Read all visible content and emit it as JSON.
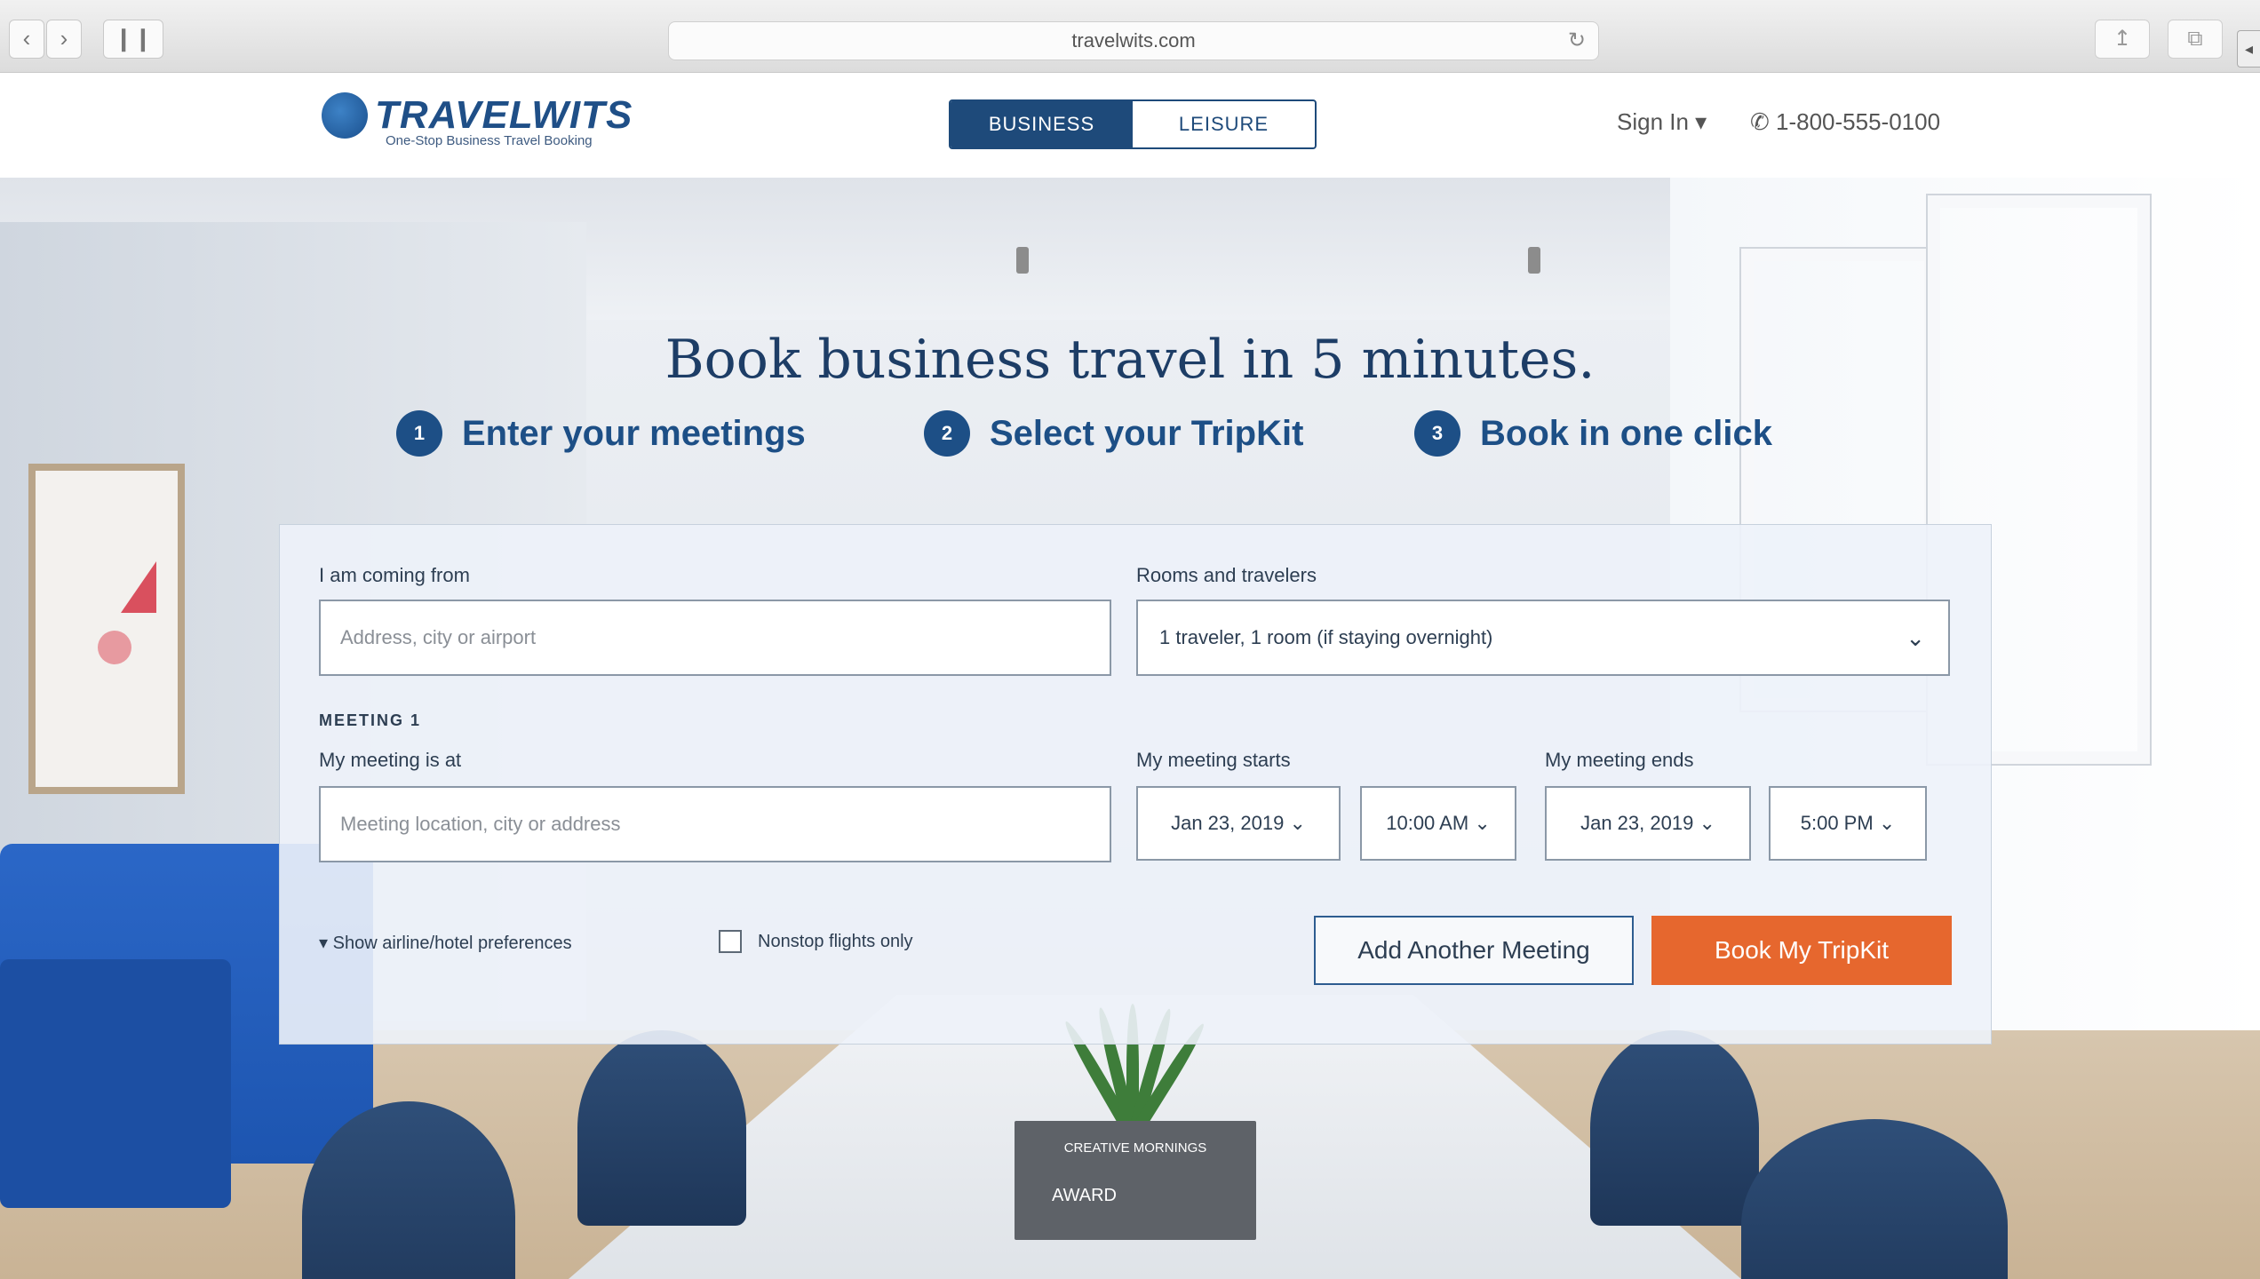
{
  "browser": {
    "back_icon": "‹",
    "forward_icon": "›",
    "sidebar_icon": "❙❙",
    "url": "travelwits.com",
    "reload_icon": "↻"
  },
  "header": {
    "brand": "TRAVELWITS",
    "tagline": "One-Stop Business Travel Booking",
    "modes": [
      "BUSINESS",
      "LEISURE"
    ],
    "sign_in": "Sign In ▾",
    "phone": "1-800-555-0100"
  },
  "hero": {
    "headline": "Book business travel in 5 minutes.",
    "steps": [
      {
        "num": "1",
        "label": "Enter your meetings"
      },
      {
        "num": "2",
        "label": "Select your TripKit"
      },
      {
        "num": "3",
        "label": "Book in one click"
      }
    ],
    "pot_caption": "CREATIVE MORNINGS",
    "pot_note": "AWARD"
  },
  "form": {
    "coming_from_label": "I am coming from",
    "coming_from_placeholder": "Address, city or airport",
    "rooms_label": "Rooms and travelers",
    "rooms_value": "1 traveler, 1 room (if staying overnight)",
    "meeting_section": "MEETING 1",
    "meeting_location_label": "My meeting is at",
    "meeting_location_placeholder": "Meeting location, city or address",
    "starts_label": "My meeting starts",
    "start_date": "Jan 23, 2019",
    "start_time": "10:00 AM",
    "ends_label": "My meeting ends",
    "end_date": "Jan 23, 2019",
    "end_time": "5:00 PM",
    "advanced_toggle": "Show airline/hotel preferences",
    "nonstop_label": "Nonstop flights only",
    "add_meeting": "Add Another Meeting",
    "book": "Book My TripKit"
  },
  "colors": {
    "brand_blue": "#1e4a7a",
    "cta_orange": "#e6672e"
  }
}
